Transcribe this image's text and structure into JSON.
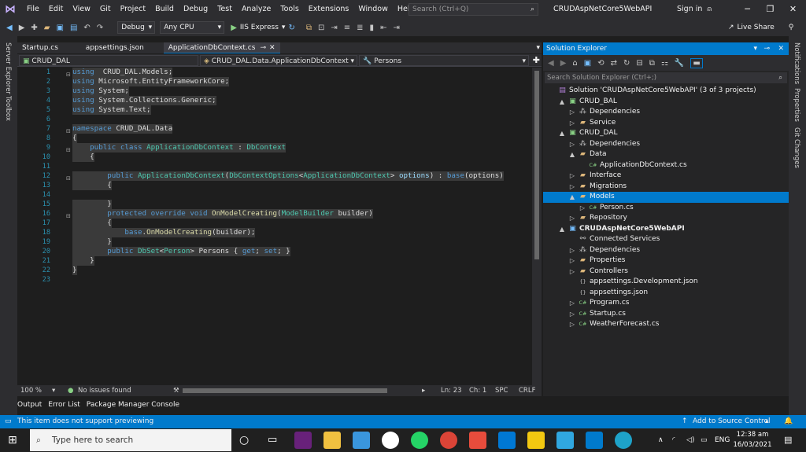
{
  "menubar": {
    "items": [
      "File",
      "Edit",
      "View",
      "Git",
      "Project",
      "Build",
      "Debug",
      "Test",
      "Analyze",
      "Tools",
      "Extensions",
      "Window",
      "Help"
    ],
    "search_placeholder": "Search (Ctrl+Q)",
    "solution_name": "CRUDAspNetCore5WebAPI",
    "sign_in": "Sign in"
  },
  "toolbar": {
    "config": "Debug",
    "platform": "Any CPU",
    "run_target": "IIS Express",
    "live_share": "Live Share"
  },
  "side_panels": {
    "left": [
      "Server Explorer",
      "Toolbox"
    ],
    "right": [
      "Notifications",
      "Properties",
      "Git Changes"
    ]
  },
  "tabs": [
    {
      "label": "Startup.cs",
      "active": false
    },
    {
      "label": "appsettings.json",
      "active": false
    },
    {
      "label": "ApplicationDbContext.cs",
      "active": true
    }
  ],
  "navbar": {
    "project": "CRUD_DAL",
    "class": "CRUD_DAL.Data.ApplicationDbContext",
    "member": "Persons"
  },
  "code": {
    "line_numbers": [
      "1",
      "2",
      "3",
      "4",
      "5",
      "6",
      "7",
      "8",
      "9",
      "10",
      "11",
      "12",
      "13",
      "14",
      "15",
      "16",
      "17",
      "18",
      "19",
      "20",
      "21",
      "22",
      "23"
    ]
  },
  "editor_status": {
    "zoom": "100 %",
    "issues": "No issues found",
    "line": "Ln: 23",
    "col": "Ch: 1",
    "spc": "SPC",
    "eol": "CRLF"
  },
  "bottom_tabs": [
    "Output",
    "Error List",
    "Package Manager Console"
  ],
  "solution_explorer": {
    "title": "Solution Explorer",
    "search_placeholder": "Search Solution Explorer (Ctrl+;)",
    "items": [
      {
        "label": "Solution 'CRUDAspNetCore5WebAPI' (3 of 3 projects)",
        "depth": 0,
        "exp": "",
        "icon": "solution-icon",
        "bold": false,
        "selected": false
      },
      {
        "label": "CRUD_BAL",
        "depth": 1,
        "exp": "▲",
        "icon": "project-icon",
        "bold": false,
        "selected": false
      },
      {
        "label": "Dependencies",
        "depth": 2,
        "exp": "▷",
        "icon": "dependencies-icon",
        "bold": false,
        "selected": false
      },
      {
        "label": "Service",
        "depth": 2,
        "exp": "▷",
        "icon": "folder-icon",
        "bold": false,
        "selected": false
      },
      {
        "label": "CRUD_DAL",
        "depth": 1,
        "exp": "▲",
        "icon": "project-icon",
        "bold": false,
        "selected": false
      },
      {
        "label": "Dependencies",
        "depth": 2,
        "exp": "▷",
        "icon": "dependencies-icon",
        "bold": false,
        "selected": false
      },
      {
        "label": "Data",
        "depth": 2,
        "exp": "▲",
        "icon": "folder-icon",
        "bold": false,
        "selected": false
      },
      {
        "label": "ApplicationDbContext.cs",
        "depth": 3,
        "exp": "",
        "icon": "csharp-file-icon",
        "bold": false,
        "selected": false
      },
      {
        "label": "Interface",
        "depth": 2,
        "exp": "▷",
        "icon": "folder-icon",
        "bold": false,
        "selected": false
      },
      {
        "label": "Migrations",
        "depth": 2,
        "exp": "▷",
        "icon": "folder-icon",
        "bold": false,
        "selected": false
      },
      {
        "label": "Models",
        "depth": 2,
        "exp": "▲",
        "icon": "folder-icon",
        "bold": false,
        "selected": true
      },
      {
        "label": "Person.cs",
        "depth": 3,
        "exp": "▷",
        "icon": "csharp-file-icon",
        "bold": false,
        "selected": false
      },
      {
        "label": "Repository",
        "depth": 2,
        "exp": "▷",
        "icon": "folder-icon",
        "bold": false,
        "selected": false
      },
      {
        "label": "CRUDAspNetCore5WebAPI",
        "depth": 1,
        "exp": "▲",
        "icon": "web-project-icon",
        "bold": true,
        "selected": false
      },
      {
        "label": "Connected Services",
        "depth": 2,
        "exp": "",
        "icon": "connected-services-icon",
        "bold": false,
        "selected": false
      },
      {
        "label": "Dependencies",
        "depth": 2,
        "exp": "▷",
        "icon": "dependencies-icon",
        "bold": false,
        "selected": false
      },
      {
        "label": "Properties",
        "depth": 2,
        "exp": "▷",
        "icon": "folder-icon",
        "bold": false,
        "selected": false
      },
      {
        "label": "Controllers",
        "depth": 2,
        "exp": "▷",
        "icon": "folder-icon",
        "bold": false,
        "selected": false
      },
      {
        "label": "appsettings.Development.json",
        "depth": 2,
        "exp": "",
        "icon": "json-file-icon",
        "bold": false,
        "selected": false
      },
      {
        "label": "appsettings.json",
        "depth": 2,
        "exp": "",
        "icon": "json-file-icon",
        "bold": false,
        "selected": false
      },
      {
        "label": "Program.cs",
        "depth": 2,
        "exp": "▷",
        "icon": "csharp-file-icon",
        "bold": false,
        "selected": false
      },
      {
        "label": "Startup.cs",
        "depth": 2,
        "exp": "▷",
        "icon": "csharp-file-icon",
        "bold": false,
        "selected": false
      },
      {
        "label": "WeatherForecast.cs",
        "depth": 2,
        "exp": "▷",
        "icon": "csharp-file-icon",
        "bold": false,
        "selected": false
      }
    ]
  },
  "statusbar": {
    "message": "This item does not support previewing",
    "source_control": "Add to Source Control"
  },
  "taskbar": {
    "search_placeholder": "Type here to search",
    "time": "12:38 am",
    "date": "16/03/2021",
    "lang": "ENG"
  },
  "colors": {
    "accent": "#007acc",
    "editor_bg": "#1e1e1e",
    "keyword": "#569cd6",
    "type": "#4ec9b0"
  }
}
